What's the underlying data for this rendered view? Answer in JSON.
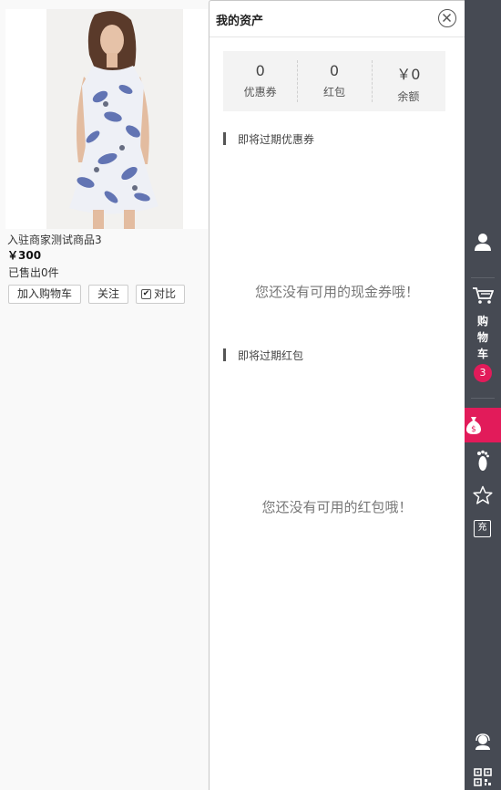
{
  "product": {
    "name": "入驻商家测试商品3",
    "price": "￥300",
    "sold": "已售出0件",
    "buttons": {
      "add_cart": "加入购物车",
      "follow": "关注",
      "compare": "对比"
    },
    "compare_checked": true,
    "image_icon": "dress-photo"
  },
  "panel": {
    "title": "我的资产",
    "stats": [
      {
        "value": "0",
        "label": "优惠券"
      },
      {
        "value": "0",
        "label": "红包"
      },
      {
        "value": "￥0",
        "label": "余额"
      }
    ],
    "coupon_section": {
      "title": "即将过期优惠券",
      "empty_text": "您还没有可用的现金券哦！"
    },
    "bonus_section": {
      "title": "即将过期红包",
      "empty_text": "您还没有可用的红包哦！"
    }
  },
  "toolbar": {
    "cart_label": "购物车",
    "cart_count": "3",
    "recharge_label": "充",
    "icons": [
      "user-icon",
      "cart-icon",
      "money-bag-icon",
      "footprint-icon",
      "star-icon",
      "recharge-icon",
      "customer-service-icon",
      "qr-code-icon"
    ],
    "colors": {
      "bar": "#464a53",
      "accent": "#e21b5a"
    }
  }
}
